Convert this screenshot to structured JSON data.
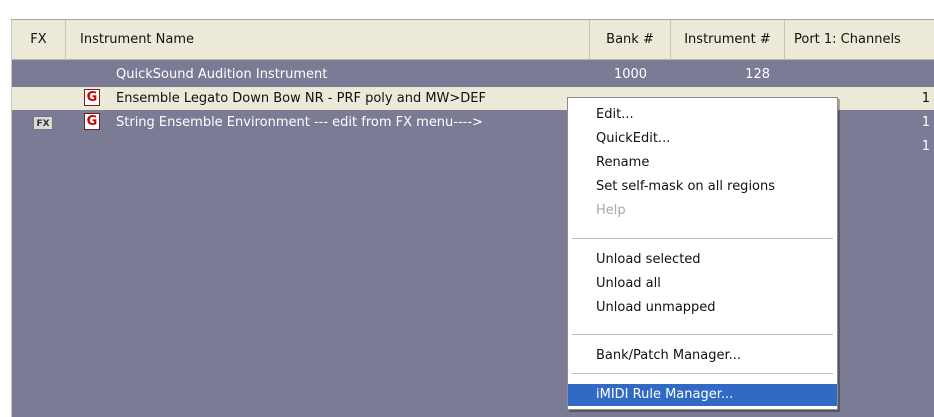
{
  "header": {
    "fx": "FX",
    "instrument_name": "Instrument Name",
    "bank": "Bank #",
    "instrument": "Instrument #",
    "port": "Port 1: Channels"
  },
  "rows": [
    {
      "fx": "",
      "icon": "speaker-icon",
      "name": "QuickSound Audition Instrument",
      "bank": "1000",
      "instrument": "128",
      "channel": "",
      "selected": false
    },
    {
      "fx": "",
      "icon": "gigastudio-instrument-icon",
      "name": "Ensemble Legato Down Bow NR - PRF poly and MW>DEF",
      "bank": "",
      "instrument": "",
      "channel": "1",
      "selected": true
    },
    {
      "fx": "FX",
      "icon": "gigastudio-instrument-icon",
      "name": "String Ensemble Environment --- edit from FX menu---->",
      "bank": "",
      "instrument": "",
      "channel": "1",
      "selected": false
    },
    {
      "fx": "",
      "icon": "",
      "name": "",
      "bank": "",
      "instrument": "",
      "channel": "1",
      "selected": false
    }
  ],
  "menu": {
    "items": [
      {
        "label": "Edit...",
        "disabled": false
      },
      {
        "label": "QuickEdit...",
        "disabled": false
      },
      {
        "label": "Rename",
        "disabled": false
      },
      {
        "label": "Set self-mask on all regions",
        "disabled": false
      },
      {
        "label": "Help",
        "disabled": true
      },
      {
        "label": "Unload selected",
        "disabled": false
      },
      {
        "label": "Unload all",
        "disabled": false
      },
      {
        "label": "Unload unmapped",
        "disabled": false
      },
      {
        "label": "Bank/Patch Manager...",
        "disabled": false
      },
      {
        "label": "iMIDI Rule Manager...",
        "disabled": false,
        "highlighted": true
      }
    ]
  },
  "colors": {
    "list_background": "#7b7b96",
    "selected_row": "#ece9d8",
    "menu_highlight": "#316ac5",
    "disabled_text": "#a8a8a8"
  },
  "icons": [
    "speaker-icon",
    "gigastudio-instrument-icon",
    "fx-badge-icon"
  ]
}
